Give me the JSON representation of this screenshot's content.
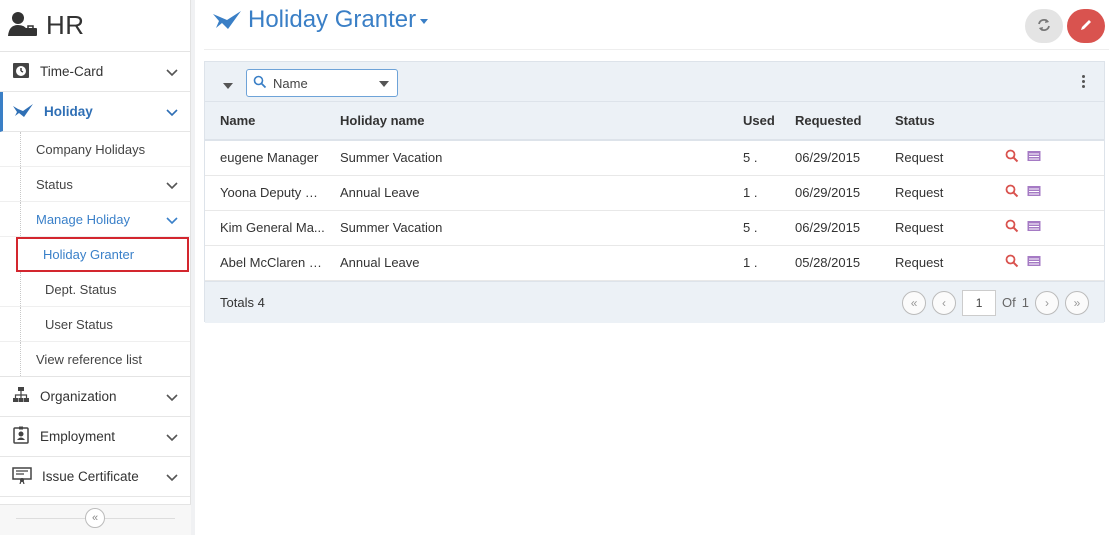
{
  "app": {
    "title": "HR"
  },
  "sidebar": {
    "items": [
      {
        "label": "Time-Card"
      },
      {
        "label": "Holiday"
      },
      {
        "label": "Organization"
      },
      {
        "label": "Employment"
      },
      {
        "label": "Issue Certificate"
      }
    ],
    "holiday_sub": [
      {
        "label": "Company Holidays"
      },
      {
        "label": "Status"
      },
      {
        "label": "Manage Holiday"
      },
      {
        "label": "View reference list"
      }
    ],
    "manage_sub": [
      {
        "label": "Holiday Granter"
      },
      {
        "label": "Dept. Status"
      },
      {
        "label": "User Status"
      }
    ]
  },
  "header": {
    "title": "Holiday Granter"
  },
  "toolbar": {
    "search_field": "Name"
  },
  "table": {
    "columns": [
      "Name",
      "Holiday name",
      "Used",
      "Requested",
      "Status"
    ],
    "rows": [
      {
        "name": "eugene Manager",
        "holiday": "Summer Vacation",
        "used": "5 .",
        "requested": "06/29/2015",
        "status": "Request"
      },
      {
        "name": "Yoona Deputy G...",
        "holiday": "Annual Leave",
        "used": "1 .",
        "requested": "06/29/2015",
        "status": "Request"
      },
      {
        "name": "Kim General Ma...",
        "holiday": "Summer Vacation",
        "used": "5 .",
        "requested": "06/29/2015",
        "status": "Request"
      },
      {
        "name": "Abel McClaren C...",
        "holiday": "Annual Leave",
        "used": "1 .",
        "requested": "05/28/2015",
        "status": "Request"
      }
    ]
  },
  "footer": {
    "totals": "Totals 4",
    "page": "1",
    "of_label": "Of",
    "total_pages": "1"
  },
  "colors": {
    "accent": "#3a7fc6",
    "danger": "#d9534f",
    "selected_outline": "#d3262e"
  }
}
